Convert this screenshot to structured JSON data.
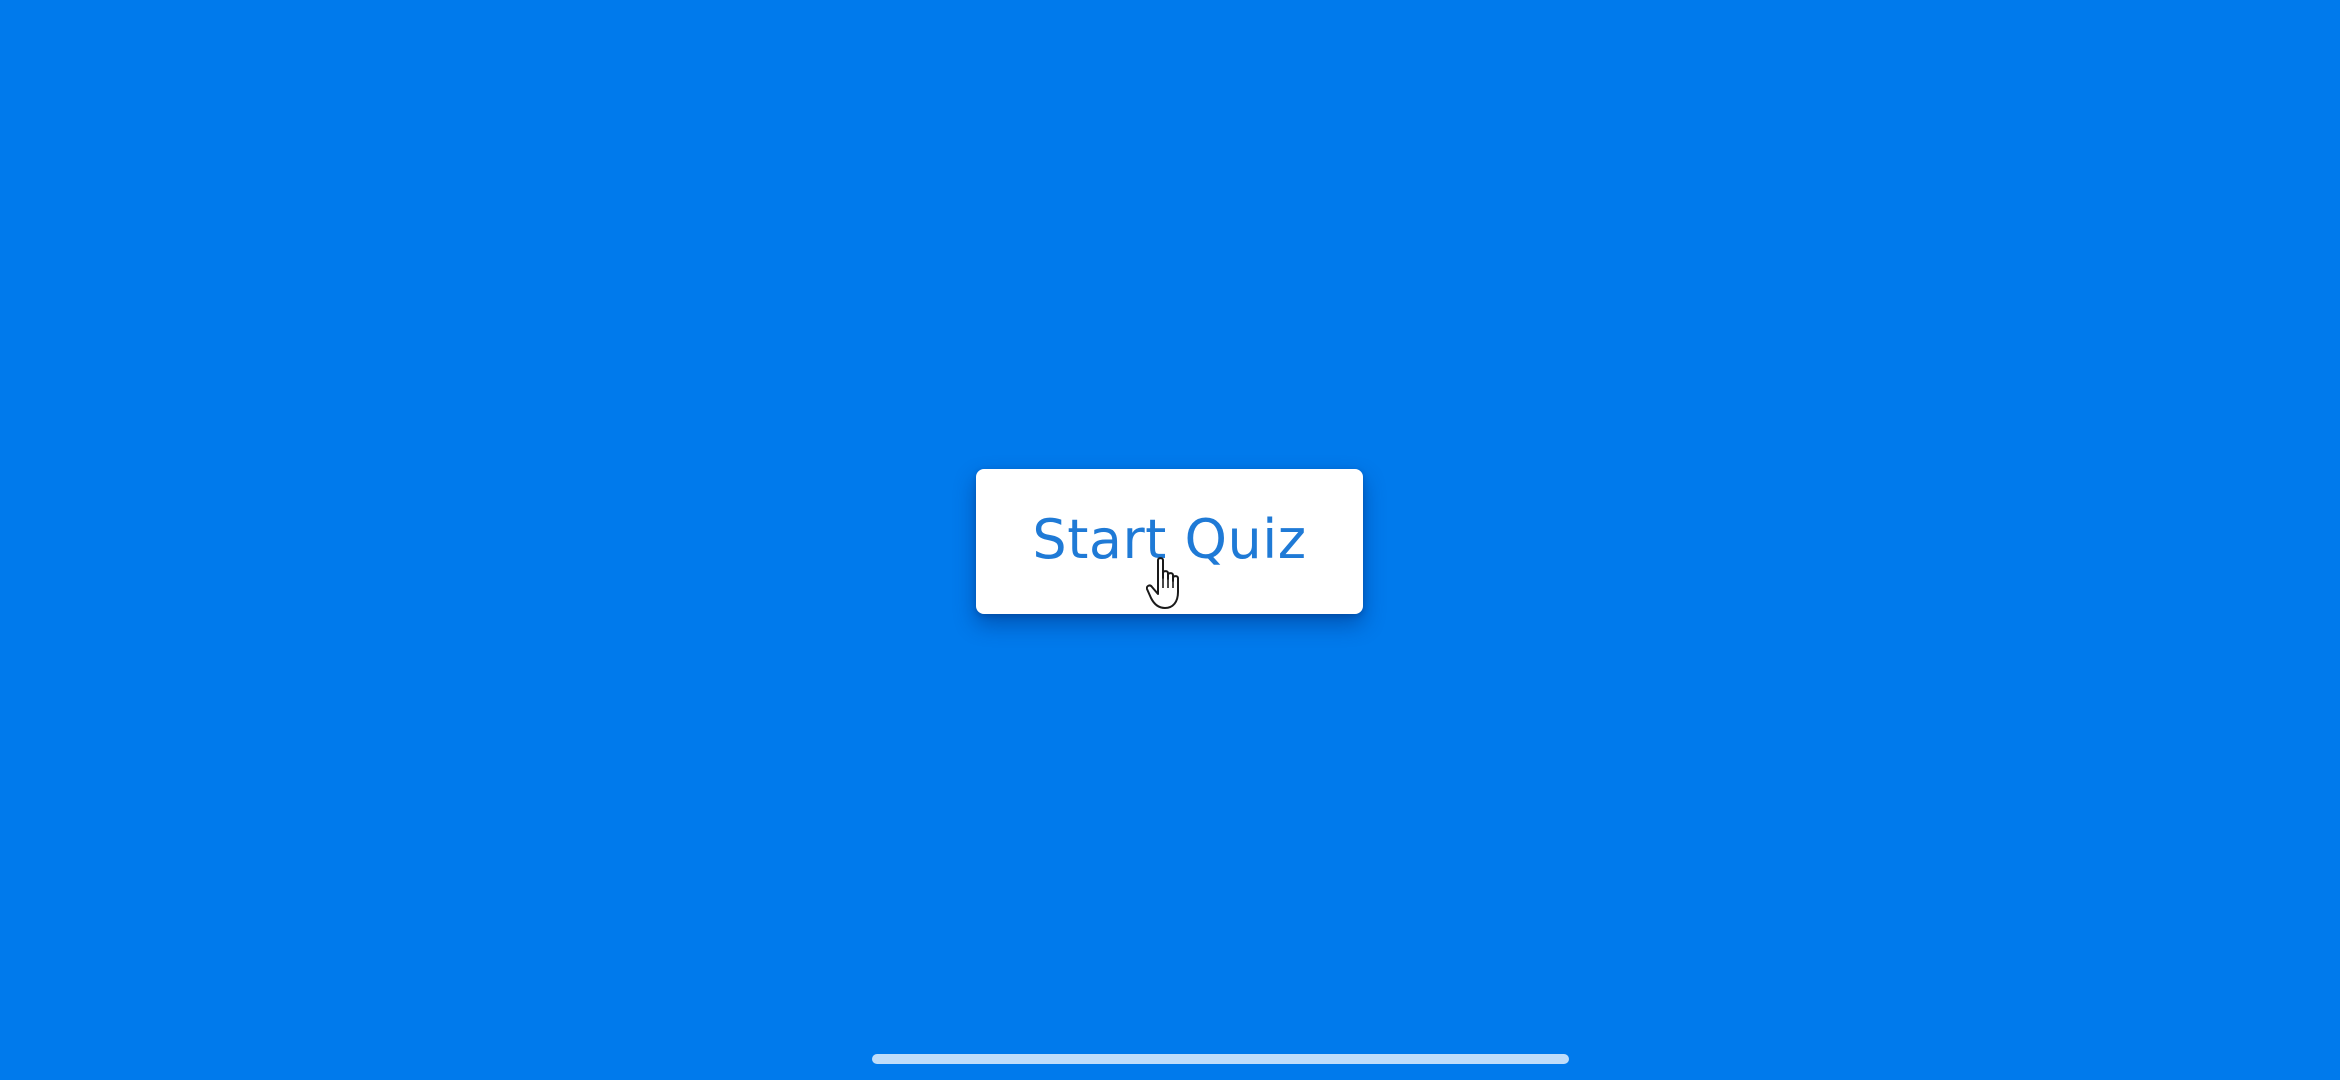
{
  "app": {
    "background_color": "#007aec",
    "accent_text_color": "#1f7ad6"
  },
  "main": {
    "start_button": {
      "label": "Start Quiz"
    }
  },
  "cursor": {
    "icon": "hand-pointer-icon"
  },
  "system": {
    "home_indicator": "home-indicator"
  }
}
